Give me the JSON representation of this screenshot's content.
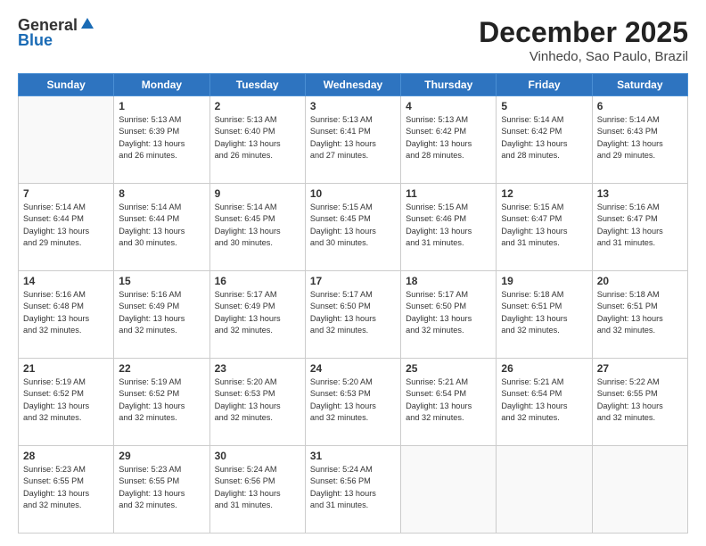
{
  "header": {
    "logo_general": "General",
    "logo_blue": "Blue",
    "month_title": "December 2025",
    "subtitle": "Vinhedo, Sao Paulo, Brazil"
  },
  "days_of_week": [
    "Sunday",
    "Monday",
    "Tuesday",
    "Wednesday",
    "Thursday",
    "Friday",
    "Saturday"
  ],
  "weeks": [
    [
      {
        "day": "",
        "info": ""
      },
      {
        "day": "1",
        "info": "Sunrise: 5:13 AM\nSunset: 6:39 PM\nDaylight: 13 hours\nand 26 minutes."
      },
      {
        "day": "2",
        "info": "Sunrise: 5:13 AM\nSunset: 6:40 PM\nDaylight: 13 hours\nand 26 minutes."
      },
      {
        "day": "3",
        "info": "Sunrise: 5:13 AM\nSunset: 6:41 PM\nDaylight: 13 hours\nand 27 minutes."
      },
      {
        "day": "4",
        "info": "Sunrise: 5:13 AM\nSunset: 6:42 PM\nDaylight: 13 hours\nand 28 minutes."
      },
      {
        "day": "5",
        "info": "Sunrise: 5:14 AM\nSunset: 6:42 PM\nDaylight: 13 hours\nand 28 minutes."
      },
      {
        "day": "6",
        "info": "Sunrise: 5:14 AM\nSunset: 6:43 PM\nDaylight: 13 hours\nand 29 minutes."
      }
    ],
    [
      {
        "day": "7",
        "info": "Sunrise: 5:14 AM\nSunset: 6:44 PM\nDaylight: 13 hours\nand 29 minutes."
      },
      {
        "day": "8",
        "info": "Sunrise: 5:14 AM\nSunset: 6:44 PM\nDaylight: 13 hours\nand 30 minutes."
      },
      {
        "day": "9",
        "info": "Sunrise: 5:14 AM\nSunset: 6:45 PM\nDaylight: 13 hours\nand 30 minutes."
      },
      {
        "day": "10",
        "info": "Sunrise: 5:15 AM\nSunset: 6:45 PM\nDaylight: 13 hours\nand 30 minutes."
      },
      {
        "day": "11",
        "info": "Sunrise: 5:15 AM\nSunset: 6:46 PM\nDaylight: 13 hours\nand 31 minutes."
      },
      {
        "day": "12",
        "info": "Sunrise: 5:15 AM\nSunset: 6:47 PM\nDaylight: 13 hours\nand 31 minutes."
      },
      {
        "day": "13",
        "info": "Sunrise: 5:16 AM\nSunset: 6:47 PM\nDaylight: 13 hours\nand 31 minutes."
      }
    ],
    [
      {
        "day": "14",
        "info": "Sunrise: 5:16 AM\nSunset: 6:48 PM\nDaylight: 13 hours\nand 32 minutes."
      },
      {
        "day": "15",
        "info": "Sunrise: 5:16 AM\nSunset: 6:49 PM\nDaylight: 13 hours\nand 32 minutes."
      },
      {
        "day": "16",
        "info": "Sunrise: 5:17 AM\nSunset: 6:49 PM\nDaylight: 13 hours\nand 32 minutes."
      },
      {
        "day": "17",
        "info": "Sunrise: 5:17 AM\nSunset: 6:50 PM\nDaylight: 13 hours\nand 32 minutes."
      },
      {
        "day": "18",
        "info": "Sunrise: 5:17 AM\nSunset: 6:50 PM\nDaylight: 13 hours\nand 32 minutes."
      },
      {
        "day": "19",
        "info": "Sunrise: 5:18 AM\nSunset: 6:51 PM\nDaylight: 13 hours\nand 32 minutes."
      },
      {
        "day": "20",
        "info": "Sunrise: 5:18 AM\nSunset: 6:51 PM\nDaylight: 13 hours\nand 32 minutes."
      }
    ],
    [
      {
        "day": "21",
        "info": "Sunrise: 5:19 AM\nSunset: 6:52 PM\nDaylight: 13 hours\nand 32 minutes."
      },
      {
        "day": "22",
        "info": "Sunrise: 5:19 AM\nSunset: 6:52 PM\nDaylight: 13 hours\nand 32 minutes."
      },
      {
        "day": "23",
        "info": "Sunrise: 5:20 AM\nSunset: 6:53 PM\nDaylight: 13 hours\nand 32 minutes."
      },
      {
        "day": "24",
        "info": "Sunrise: 5:20 AM\nSunset: 6:53 PM\nDaylight: 13 hours\nand 32 minutes."
      },
      {
        "day": "25",
        "info": "Sunrise: 5:21 AM\nSunset: 6:54 PM\nDaylight: 13 hours\nand 32 minutes."
      },
      {
        "day": "26",
        "info": "Sunrise: 5:21 AM\nSunset: 6:54 PM\nDaylight: 13 hours\nand 32 minutes."
      },
      {
        "day": "27",
        "info": "Sunrise: 5:22 AM\nSunset: 6:55 PM\nDaylight: 13 hours\nand 32 minutes."
      }
    ],
    [
      {
        "day": "28",
        "info": "Sunrise: 5:23 AM\nSunset: 6:55 PM\nDaylight: 13 hours\nand 32 minutes."
      },
      {
        "day": "29",
        "info": "Sunrise: 5:23 AM\nSunset: 6:55 PM\nDaylight: 13 hours\nand 32 minutes."
      },
      {
        "day": "30",
        "info": "Sunrise: 5:24 AM\nSunset: 6:56 PM\nDaylight: 13 hours\nand 31 minutes."
      },
      {
        "day": "31",
        "info": "Sunrise: 5:24 AM\nSunset: 6:56 PM\nDaylight: 13 hours\nand 31 minutes."
      },
      {
        "day": "",
        "info": ""
      },
      {
        "day": "",
        "info": ""
      },
      {
        "day": "",
        "info": ""
      }
    ]
  ]
}
